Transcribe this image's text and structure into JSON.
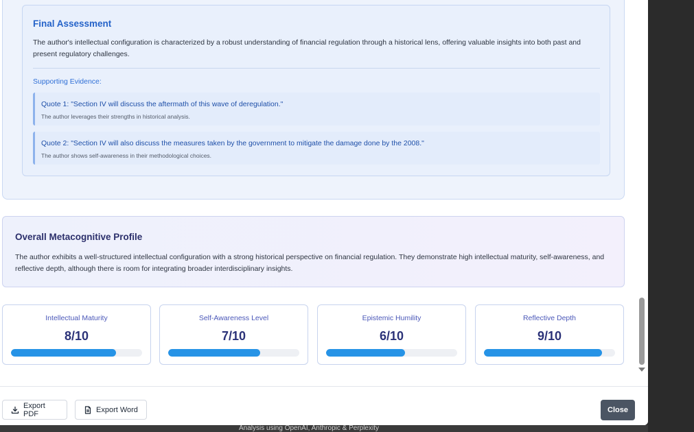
{
  "final_assessment": {
    "title": "Final Assessment",
    "text": "The author's intellectual configuration is characterized by a robust understanding of financial regulation through a historical lens, offering valuable insights into both past and present regulatory challenges.",
    "evidence_label": "Supporting Evidence:",
    "quotes": [
      {
        "text": "Quote 1: \"Section IV will discuss the aftermath of this wave of deregulation.\"",
        "note": "The author leverages their strengths in historical analysis."
      },
      {
        "text": "Quote 2: \"Section IV will also discuss the measures taken by the government to mitigate the damage done by the 2008.\"",
        "note": "The author shows self-awareness in their methodological choices."
      }
    ]
  },
  "profile": {
    "title": "Overall Metacognitive Profile",
    "text": "The author exhibits a well-structured intellectual configuration with a strong historical perspective on financial regulation. They demonstrate high intellectual maturity, self-awareness, and reflective depth, although there is room for integrating broader interdisciplinary insights."
  },
  "metrics": [
    {
      "label": "Intellectual Maturity",
      "value_text": "8/10",
      "score": 8,
      "max": 10
    },
    {
      "label": "Self-Awareness Level",
      "value_text": "7/10",
      "score": 7,
      "max": 10
    },
    {
      "label": "Epistemic Humility",
      "value_text": "6/10",
      "score": 6,
      "max": 10
    },
    {
      "label": "Reflective Depth",
      "value_text": "9/10",
      "score": 9,
      "max": 10
    }
  ],
  "footer": {
    "export_pdf": "Export PDF",
    "export_word": "Export Word",
    "close": "Close",
    "icons": {
      "pdf": "download-icon",
      "word": "document-icon"
    }
  },
  "background_credit": "Analysis using OpenAI, Anthropic & Perplexity",
  "colors": {
    "accent_blue": "#2563c9",
    "bar_fill": "#2693e6",
    "close_button": "#4b5563",
    "metric_value": "#2b3278"
  }
}
